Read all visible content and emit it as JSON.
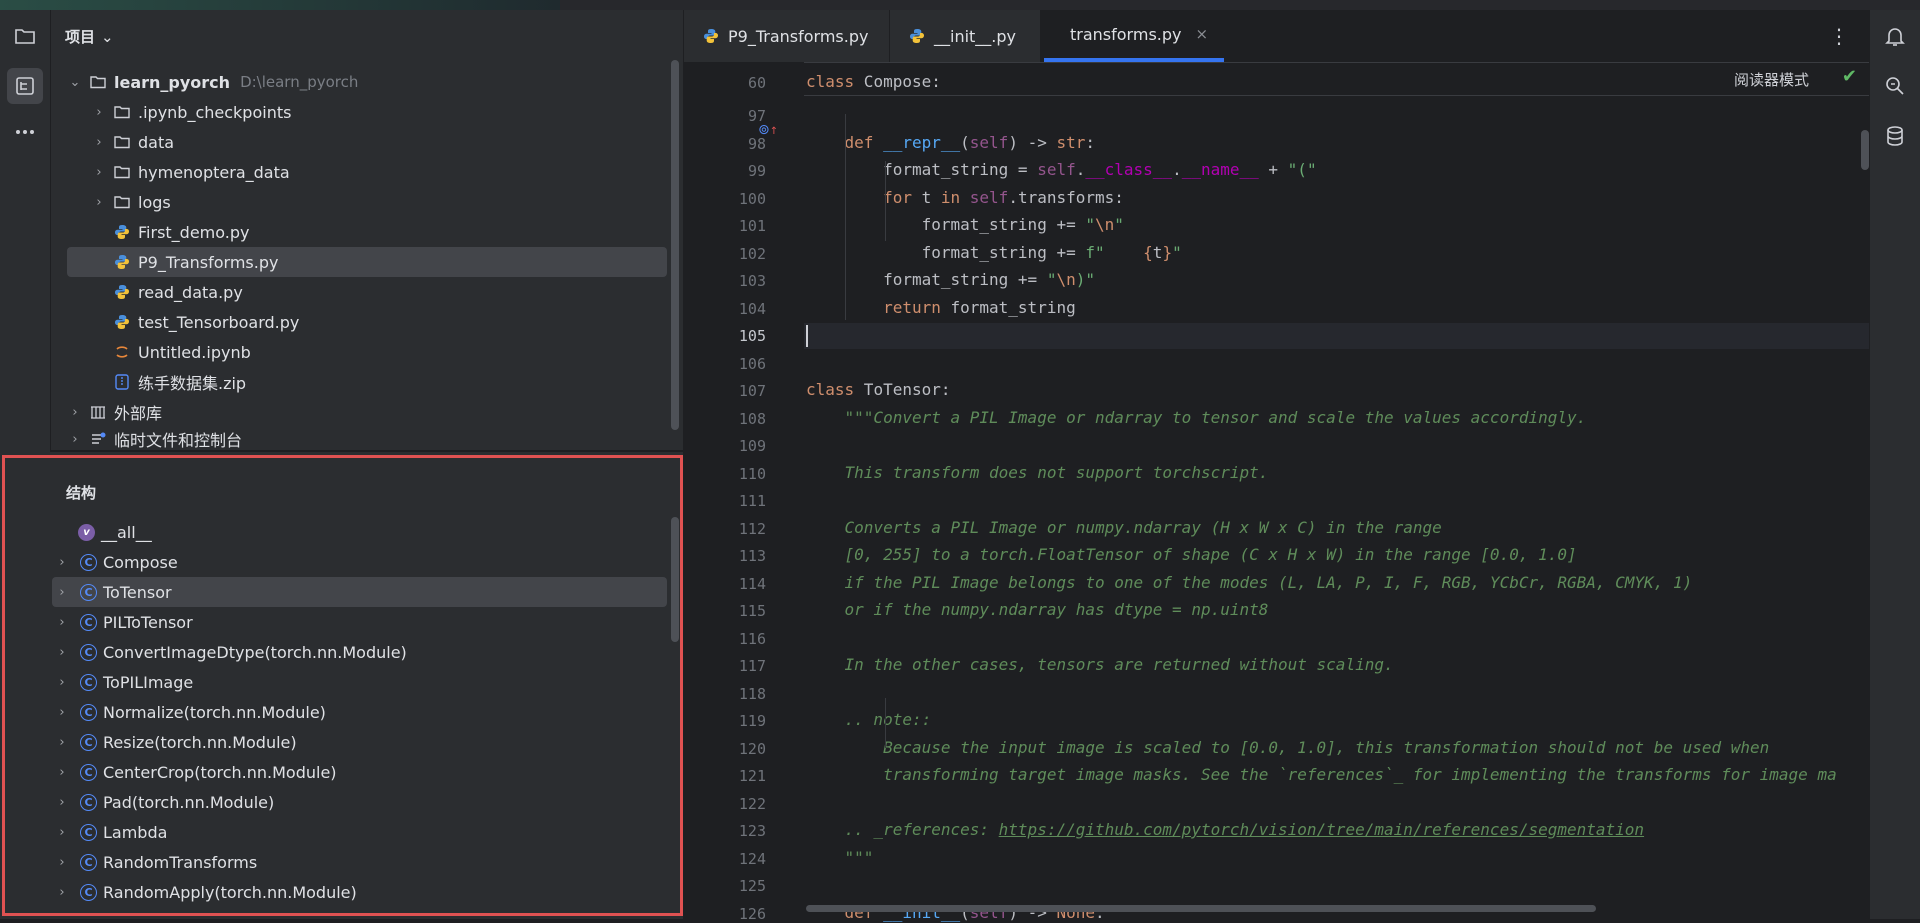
{
  "project_pane": {
    "title": "项目",
    "tree": [
      {
        "label": "learn_pyorch",
        "path": "D:\\learn_pyorch",
        "type": "folder",
        "expanded": true
      },
      {
        "label": ".ipynb_checkpoints",
        "type": "folder"
      },
      {
        "label": "data",
        "type": "folder"
      },
      {
        "label": "hymenoptera_data",
        "type": "folder"
      },
      {
        "label": "logs",
        "type": "folder"
      },
      {
        "label": "First_demo.py",
        "type": "python"
      },
      {
        "label": "P9_Transforms.py",
        "type": "python",
        "selected": true
      },
      {
        "label": "read_data.py",
        "type": "python"
      },
      {
        "label": "test_Tensorboard.py",
        "type": "python"
      },
      {
        "label": "Untitled.ipynb",
        "type": "notebook"
      },
      {
        "label": "练手数据集.zip",
        "type": "archive"
      },
      {
        "label": "外部库",
        "type": "library"
      },
      {
        "label": "临时文件和控制台",
        "type": "scratch"
      }
    ]
  },
  "structure_pane": {
    "title": "结构",
    "items": [
      {
        "label": "__all__",
        "kind": "variable"
      },
      {
        "label": "Compose",
        "kind": "class"
      },
      {
        "label": "ToTensor",
        "kind": "class",
        "selected": true
      },
      {
        "label": "PILToTensor",
        "kind": "class"
      },
      {
        "label": "ConvertImageDtype(torch.nn.Module)",
        "kind": "class"
      },
      {
        "label": "ToPILImage",
        "kind": "class"
      },
      {
        "label": "Normalize(torch.nn.Module)",
        "kind": "class"
      },
      {
        "label": "Resize(torch.nn.Module)",
        "kind": "class"
      },
      {
        "label": "CenterCrop(torch.nn.Module)",
        "kind": "class"
      },
      {
        "label": "Pad(torch.nn.Module)",
        "kind": "class"
      },
      {
        "label": "Lambda",
        "kind": "class"
      },
      {
        "label": "RandomTransforms",
        "kind": "class"
      },
      {
        "label": "RandomApply(torch.nn.Module)",
        "kind": "class"
      }
    ]
  },
  "editor": {
    "tabs": [
      {
        "label": "P9_Transforms.py",
        "active": false
      },
      {
        "label": "__init__.py",
        "active": false
      },
      {
        "label": "transforms.py",
        "active": true,
        "close": "×"
      }
    ],
    "menu": "⋮",
    "reader_mode": "阅读器模式",
    "check": "✔",
    "gutter_mark": "⊚",
    "gutter_mark_up": "↑",
    "sticky": {
      "line": "60",
      "code": [
        [
          "kw",
          "class"
        ],
        [
          "",
          " Compose:"
        ]
      ]
    },
    "current_line": "105",
    "lines": [
      {
        "n": "97",
        "code": []
      },
      {
        "n": "98",
        "code": [
          [
            "",
            "    "
          ],
          [
            "kw",
            "def"
          ],
          [
            "",
            ""
          ],
          [
            "fn",
            " __repr__"
          ],
          [
            "",
            "("
          ],
          [
            "slf",
            "self"
          ],
          [
            "",
            ") -> "
          ],
          [
            "kw",
            "str"
          ],
          [
            "",
            ":"
          ]
        ]
      },
      {
        "n": "99",
        "code": [
          [
            "",
            "        format_string = "
          ],
          [
            "slf",
            "self"
          ],
          [
            "",
            "."
          ],
          [
            "dunder",
            "__class__"
          ],
          [
            "",
            "."
          ],
          [
            "dunder",
            "__name__"
          ],
          [
            "",
            ""
          ],
          [
            "",
            " + "
          ],
          [
            "str",
            "\"(\""
          ]
        ]
      },
      {
        "n": "100",
        "code": [
          [
            "",
            "        "
          ],
          [
            "kw",
            "for"
          ],
          [
            "",
            " t "
          ],
          [
            "kw",
            "in"
          ],
          [
            "",
            " "
          ],
          [
            "slf",
            "self"
          ],
          [
            "",
            ".transforms:"
          ]
        ]
      },
      {
        "n": "101",
        "code": [
          [
            "",
            "            format_string += "
          ],
          [
            "str",
            "\""
          ],
          [
            "esc",
            "\\n"
          ],
          [
            "str",
            "\""
          ]
        ]
      },
      {
        "n": "102",
        "code": [
          [
            "",
            "            format_string += "
          ],
          [
            "str",
            "f\"    "
          ],
          [
            "fbrace",
            "{"
          ],
          [
            "",
            "t"
          ],
          [
            "fbrace",
            "}"
          ],
          [
            "str",
            "\""
          ]
        ]
      },
      {
        "n": "103",
        "code": [
          [
            "",
            "        format_string += "
          ],
          [
            "str",
            "\""
          ],
          [
            "esc",
            "\\n"
          ],
          [
            "str",
            ")\""
          ]
        ]
      },
      {
        "n": "104",
        "code": [
          [
            "",
            "        "
          ],
          [
            "kw",
            "return"
          ],
          [
            "",
            " format_string"
          ]
        ]
      },
      {
        "n": "105",
        "code": []
      },
      {
        "n": "106",
        "code": []
      },
      {
        "n": "107",
        "code": [
          [
            "kw",
            "class"
          ],
          [
            "",
            " ToTensor:"
          ]
        ]
      },
      {
        "n": "108",
        "code": [
          [
            "",
            "    "
          ],
          [
            "doc",
            "\"\"\"Convert a PIL Image or ndarray to tensor and scale the values accordingly."
          ]
        ]
      },
      {
        "n": "109",
        "code": []
      },
      {
        "n": "110",
        "code": [
          [
            "",
            "    "
          ],
          [
            "doc",
            "This transform does not support torchscript."
          ]
        ]
      },
      {
        "n": "111",
        "code": []
      },
      {
        "n": "112",
        "code": [
          [
            "",
            "    "
          ],
          [
            "doc",
            "Converts a PIL Image or numpy.ndarray (H x W x C) in the range"
          ]
        ]
      },
      {
        "n": "113",
        "code": [
          [
            "",
            "    "
          ],
          [
            "doc",
            "[0, 255] to a torch.FloatTensor of shape (C x H x W) in the range [0.0, 1.0]"
          ]
        ]
      },
      {
        "n": "114",
        "code": [
          [
            "",
            "    "
          ],
          [
            "doc",
            "if the PIL Image belongs to one of the modes (L, LA, P, I, F, RGB, YCbCr, RGBA, CMYK, 1)"
          ]
        ]
      },
      {
        "n": "115",
        "code": [
          [
            "",
            "    "
          ],
          [
            "doc",
            "or if the numpy.ndarray has dtype = np.uint8"
          ]
        ]
      },
      {
        "n": "116",
        "code": []
      },
      {
        "n": "117",
        "code": [
          [
            "",
            "    "
          ],
          [
            "doc",
            "In the other cases, tensors are returned without scaling."
          ]
        ]
      },
      {
        "n": "118",
        "code": []
      },
      {
        "n": "119",
        "code": [
          [
            "",
            "    "
          ],
          [
            "doc",
            ".. note::"
          ]
        ]
      },
      {
        "n": "120",
        "code": [
          [
            "",
            "        "
          ],
          [
            "doc",
            "Because the input image is scaled to [0.0, 1.0], this transformation should not be used when"
          ]
        ]
      },
      {
        "n": "121",
        "code": [
          [
            "",
            "        "
          ],
          [
            "doc",
            "transforming target image masks. See the `references`_ for implementing the transforms for image ma"
          ]
        ]
      },
      {
        "n": "122",
        "code": []
      },
      {
        "n": "123",
        "code": [
          [
            "",
            "    "
          ],
          [
            "doc",
            ".. _references: "
          ],
          [
            "link",
            "https://github.com/pytorch/vision/tree/main/references/segmentation"
          ]
        ]
      },
      {
        "n": "124",
        "code": [
          [
            "",
            "    "
          ],
          [
            "doc",
            "\"\"\""
          ]
        ]
      },
      {
        "n": "125",
        "code": []
      },
      {
        "n": "126",
        "code": [
          [
            "",
            "    "
          ],
          [
            "kw",
            "def"
          ],
          [
            "fn",
            " __init__"
          ],
          [
            "",
            "("
          ],
          [
            "slf",
            "self"
          ],
          [
            "",
            ") -> "
          ],
          [
            "kw",
            "None"
          ],
          [
            "",
            ":"
          ]
        ]
      }
    ]
  },
  "colors": {
    "accent": "#3574f0",
    "highlight_border": "#e05252",
    "class_icon": "#548af7"
  }
}
